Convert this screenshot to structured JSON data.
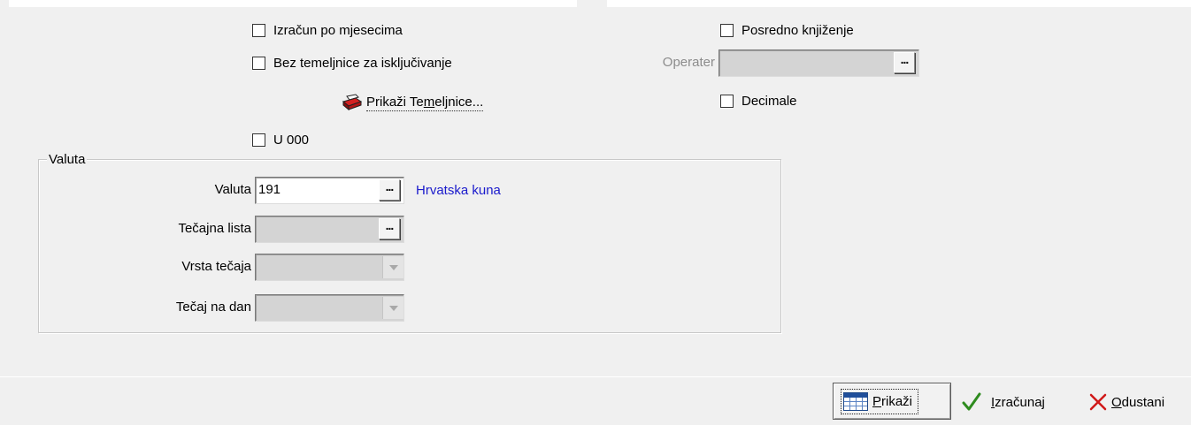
{
  "checkboxes": {
    "izracun_po_mjesecima": {
      "label": "Izračun po mjesecima",
      "checked": false
    },
    "bez_temeljnice": {
      "label": "Bez temeljnice za isključivanje",
      "checked": false
    },
    "u_000": {
      "label": "U 000",
      "checked": false
    },
    "posredno_knjizenje": {
      "label": "Posredno knjiženje",
      "checked": false
    },
    "decimale": {
      "label": "Decimale",
      "checked": false
    }
  },
  "operater": {
    "label": "Operater",
    "value": "",
    "button": "..."
  },
  "prikazi_temeljnice": {
    "pre": "Prikaži Te",
    "underlined": "m",
    "post": "eljnice..."
  },
  "valuta_group": {
    "title": "Valuta",
    "valuta": {
      "label": "Valuta",
      "value": "191",
      "button": "...",
      "description": "Hrvatska kuna"
    },
    "tecajna_lista": {
      "label": "Tečajna lista",
      "value": "",
      "button": "..."
    },
    "vrsta_tecaja": {
      "label": "Vrsta tečaja",
      "value": ""
    },
    "tecaj_na_dan": {
      "label": "Tečaj na dan",
      "value": ""
    }
  },
  "toolbar": {
    "prikazi": {
      "mnemonic": "P",
      "rest": "rikaži"
    },
    "izracunaj": {
      "mnemonic": "I",
      "rest": "zračunaj"
    },
    "odustani": {
      "mnemonic": "O",
      "rest": "dustani"
    }
  },
  "colors": {
    "background": "#f0f0f0",
    "link_blue": "#1a1acc",
    "check_green": "#2e8b1e",
    "cancel_red": "#d01818"
  }
}
